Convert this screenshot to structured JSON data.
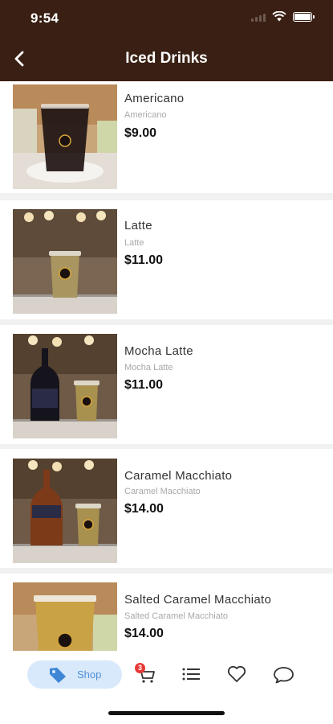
{
  "status": {
    "time": "9:54"
  },
  "header": {
    "title": "Iced Drinks"
  },
  "products": [
    {
      "name": "Americano",
      "subtitle": "Americano",
      "price": "$9.00"
    },
    {
      "name": "Latte",
      "subtitle": "Latte",
      "price": "$11.00"
    },
    {
      "name": "Mocha Latte",
      "subtitle": "Mocha Latte",
      "price": "$11.00"
    },
    {
      "name": "Caramel Macchiato",
      "subtitle": "Caramel Macchiato",
      "price": "$14.00"
    },
    {
      "name": "Salted Caramel Macchiato",
      "subtitle": "Salted Caramel Macchiato",
      "price": "$14.00"
    }
  ],
  "bottom_nav": {
    "shop_label": "Shop",
    "cart_badge": "3",
    "icons": [
      "tag-icon",
      "cart-icon",
      "list-icon",
      "heart-icon",
      "chat-icon"
    ]
  },
  "colors": {
    "header_bg": "#3a2014",
    "accent": "#4e8fd9",
    "shop_pill": "#d8e9fb",
    "badge": "#e53935"
  }
}
